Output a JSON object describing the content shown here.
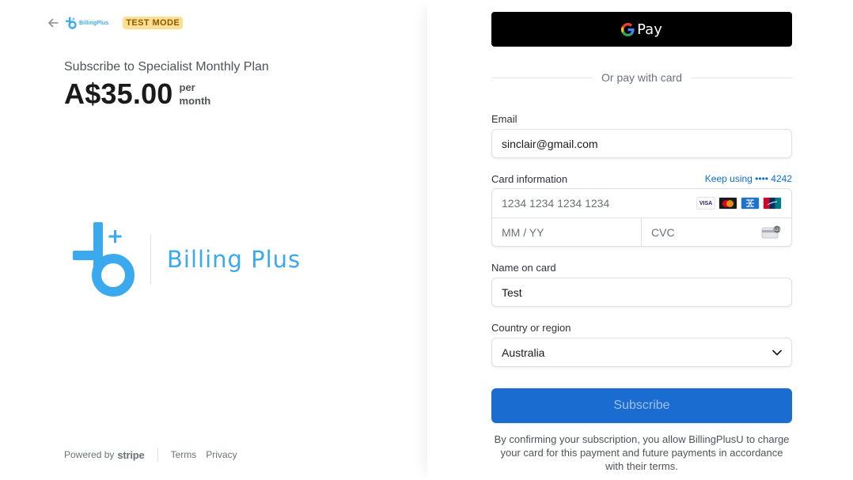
{
  "header": {
    "back_icon": "arrow-left-icon",
    "brand_small": "BillingPlus",
    "test_badge": "TEST MODE"
  },
  "summary": {
    "plan_title": "Subscribe to Specialist Monthly Plan",
    "price": "A$35.00",
    "period_line1": "per",
    "period_line2": "month"
  },
  "logo": {
    "text": "Billing Plus",
    "color": "#3aa9ee"
  },
  "footer": {
    "powered_by": "Powered by",
    "stripe": "stripe",
    "terms": "Terms",
    "privacy": "Privacy"
  },
  "payment": {
    "gpay_label": "Pay",
    "divider_text": "Or pay with card",
    "email_label": "Email",
    "email_value": "sinclair@gmail.com",
    "card_label": "Card information",
    "keep_using": "Keep using •••• 4242",
    "card_number_placeholder": "1234 1234 1234 1234",
    "expiry_placeholder": "MM / YY",
    "cvc_placeholder": "CVC",
    "card_brands": [
      "VISA",
      "mastercard",
      "amex",
      "unionpay"
    ],
    "name_label": "Name on card",
    "name_value": "Test",
    "country_label": "Country or region",
    "country_value": "Australia",
    "subscribe_label": "Subscribe",
    "consent": "By confirming your subscription, you allow BillingPlusU to charge your card for this payment and future payments in accordance with their terms."
  },
  "colors": {
    "accent": "#1b6cd1",
    "link": "#0b6fd6",
    "badge_bg": "#ffde92",
    "badge_text": "#8a5a00"
  }
}
